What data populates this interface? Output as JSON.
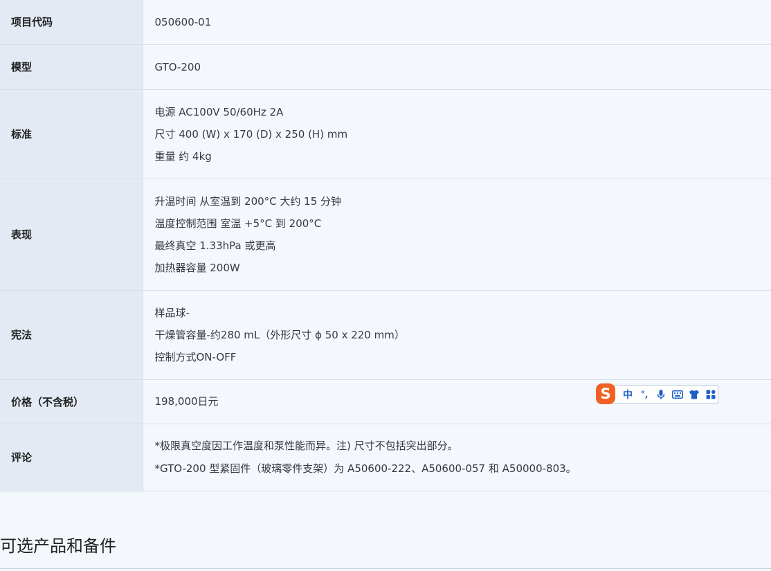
{
  "spec_table": {
    "rows": [
      {
        "label": "项目代码",
        "lines": [
          "050600-01"
        ]
      },
      {
        "label": "模型",
        "lines": [
          "GTO-200"
        ]
      },
      {
        "label": "标准",
        "lines": [
          "电源 AC100V 50/60Hz 2A",
          "尺寸 400 (W) x 170 (D) x 250 (H) mm",
          "重量 约 4kg"
        ]
      },
      {
        "label": "表现",
        "lines": [
          "升温时间 从室温到 200°C 大约 15 分钟",
          "温度控制范围 室温 +5°C 到 200°C",
          "最终真空 1.33hPa 或更高",
          "加热器容量 200W"
        ]
      },
      {
        "label": "宪法",
        "lines": [
          "样品球-",
          "干燥管容量-约280 mL（外形尺寸 ϕ 50 x 220 mm）",
          "控制方式ON-OFF"
        ]
      },
      {
        "label": "价格（不含税）",
        "lines": [
          "198,000日元"
        ]
      },
      {
        "label": "评论",
        "lines": [
          "*极限真空度因工作温度和泵性能而异。注) 尺寸不包括突出部分。",
          "*GTO-200 型紧固件（玻璃零件支架）为 A50600-222、A50600-057 和 A50000-803。"
        ]
      }
    ]
  },
  "section": {
    "title": "可选产品和备件"
  },
  "ime_toolbar": {
    "logo_letter": "S",
    "mode_label": "中",
    "punct_label": "°,",
    "icons": [
      "voice-icon",
      "keyboard-icon",
      "skin-icon",
      "toolbox-icon"
    ],
    "colors": {
      "logo": "#f06024",
      "icons": "#1f5fc9"
    }
  }
}
